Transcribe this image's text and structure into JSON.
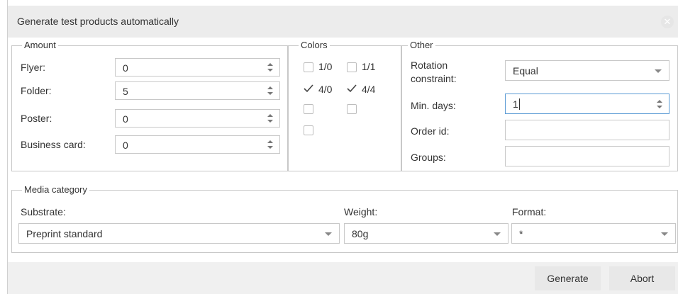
{
  "dialog": {
    "title": "Generate test products automatically",
    "close_icon": "close-icon"
  },
  "amount": {
    "legend": "Amount",
    "rows": [
      {
        "label": "Flyer:",
        "value": "0"
      },
      {
        "label": "Folder:",
        "value": "5"
      },
      {
        "label": "Poster:",
        "value": "0"
      },
      {
        "label": "Business card:",
        "value": "0"
      }
    ]
  },
  "colors": {
    "legend": "Colors",
    "items": [
      {
        "label": "1/0",
        "checked": false
      },
      {
        "label": "1/1",
        "checked": false
      },
      {
        "label": "4/0",
        "checked": true
      },
      {
        "label": "4/4",
        "checked": true
      },
      {
        "label": "",
        "checked": false
      },
      {
        "label": "",
        "checked": false
      },
      {
        "label": "",
        "checked": false
      }
    ]
  },
  "other": {
    "legend": "Other",
    "rotation_label": "Rotation constraint:",
    "rotation_value": "Equal",
    "min_days_label": "Min. days:",
    "min_days_value": "1",
    "order_id_label": "Order id:",
    "order_id_value": "",
    "groups_label": "Groups:",
    "groups_value": ""
  },
  "media": {
    "legend": "Media category",
    "substrate_label": "Substrate:",
    "substrate_value": "Preprint standard",
    "weight_label": "Weight:",
    "weight_value": "80g",
    "format_label": "Format:",
    "format_value": "*"
  },
  "footer": {
    "generate_label": "Generate",
    "abort_label": "Abort"
  }
}
